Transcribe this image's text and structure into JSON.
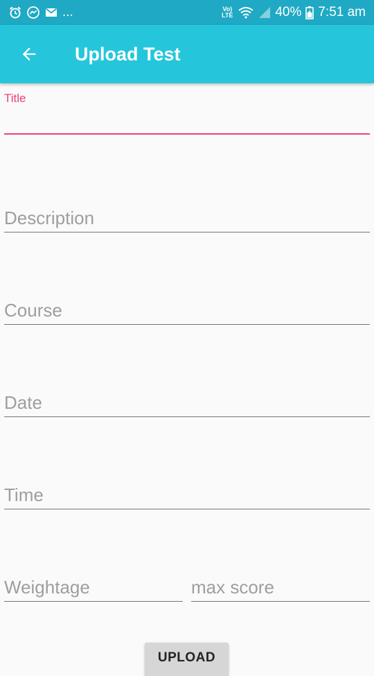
{
  "status_bar": {
    "left_more": "...",
    "lte_top": "Vo)",
    "lte_bottom": "LTE",
    "battery": "40%",
    "time": "7:51 am"
  },
  "app_bar": {
    "title": "Upload Test"
  },
  "form": {
    "title_label": "Title",
    "title_value": "",
    "description_placeholder": "Description",
    "course_placeholder": "Course",
    "date_placeholder": "Date",
    "time_placeholder": "Time",
    "weightage_placeholder": "Weightage",
    "max_score_placeholder": "max score",
    "upload_label": "UPLOAD"
  },
  "colors": {
    "status_bar": "#1fa9c4",
    "app_bar": "#25c6dc",
    "accent": "#ec407a",
    "background": "#fafafa"
  }
}
